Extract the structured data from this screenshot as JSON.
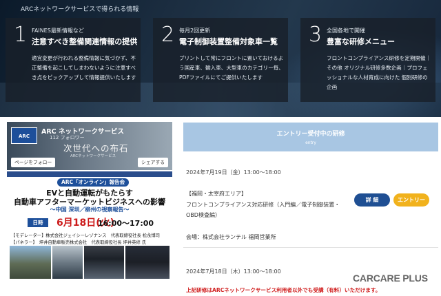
{
  "hero": {
    "title": "ARCネットワークサービスで得られる情報",
    "cards": [
      {
        "num": "1",
        "small": "FAINES最新情報など",
        "big": "注意すべき整備関連情報の提供",
        "desc": "適宜変更が行われる整備情報に気づかず、不正整備を起こしてしまわないように注意すべき点をピックアップして情報提供いたします"
      },
      {
        "num": "2",
        "small": "毎月2回更新",
        "big": "電子制御装置整備対象車一覧",
        "desc": "プリントして常にフロントに置いておけるよう国産車、輸入車、大型車のカテゴリー毎、PDFファイルにてご提供いたします"
      },
      {
        "num": "3",
        "small": "全国各地で開催",
        "big": "豊富な研修メニュー",
        "desc": "フロントコンプライアンス研修を定期開催｜その他 オリジナル研修多数企画｜プロフェッショナルな人材育成に向けた 個別研修の企画"
      }
    ]
  },
  "facebook": {
    "logo": "ARC",
    "name": "ARC ネットワークサービス",
    "followers": "112 フォロワー",
    "tagline": "次世代への布石",
    "tagline_small": "ARCネットワークサービス",
    "follow_label": "ページをフォロー",
    "share_label": "シェアする",
    "post": {
      "label": "ARC「オンライン」報告会",
      "title1": "EVと自動運転がもたらす",
      "title2": "自動車アフターマーケットビジネスへの影響",
      "subtitle": "〜中国 深圳／柳州の視察報告〜",
      "day_label": "日時",
      "date": "6月18日(火)",
      "time": "16:00〜17:00",
      "moderator": "【モデレーター】株式会社ジェイシーレゾナンス　代表取締役社長 松永博司",
      "panelist": "【パネラー】　坪井自動車販売株式会社　代表取締役社長 坪井英修 氏"
    }
  },
  "entry": {
    "title": "エントリー受付中の研修",
    "subtitle": "entry",
    "events": [
      {
        "date": "2024年7月19日（金）13:00〜18:00",
        "region": "【福岡・太宰府エリア】",
        "title1": "フロントコンプライアンス対応研修（入門編／電子制御装置・",
        "title2": "OBD検査編）",
        "venue": "会場：株式会社ランテル 福岡営業所",
        "detail_label": "詳 細",
        "entry_label": "エントリー"
      },
      {
        "date": "2024年7月18日（木）13:00〜18:00"
      }
    ],
    "notice": "上記研修はARCネットワークサービス利用者以外でも受講（有料）いただけます。"
  },
  "watermark": "CARCARE PLUS"
}
